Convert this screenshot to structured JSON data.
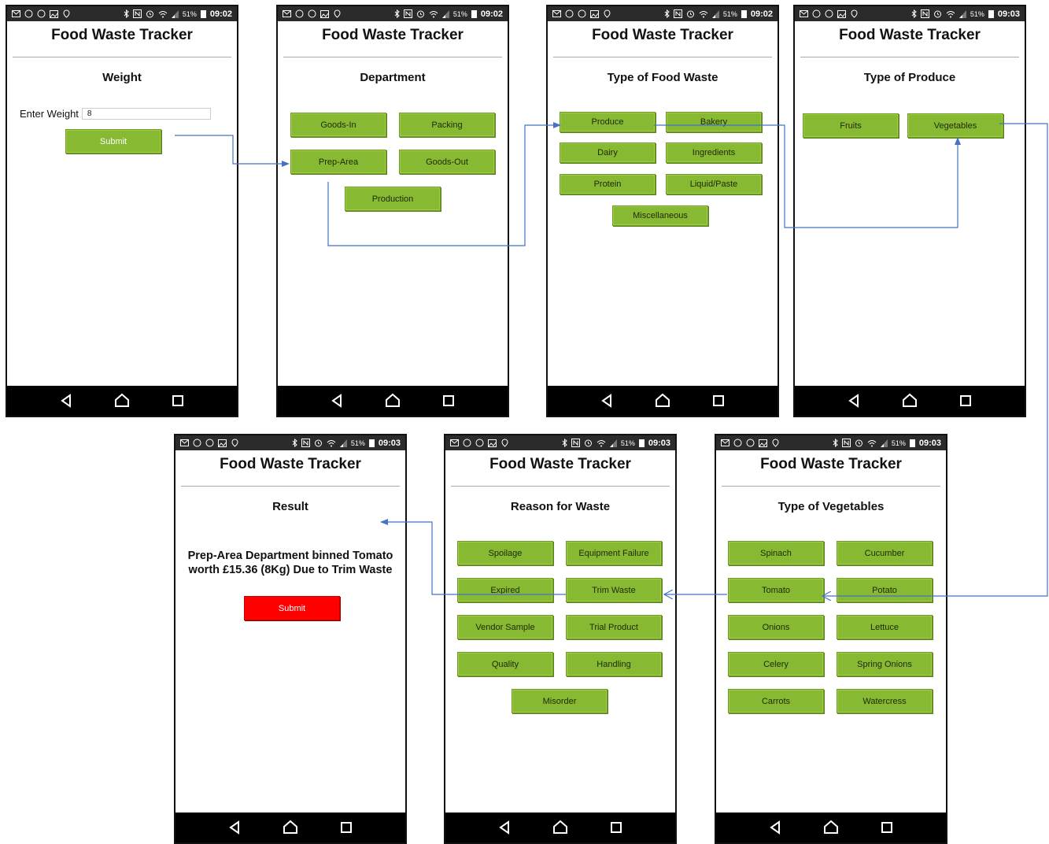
{
  "app_title": "Food Waste Tracker",
  "screens": {
    "weight": {
      "time": "09:02",
      "battery": "51%",
      "section": "Weight",
      "label": "Enter Weight",
      "value": "8",
      "submit": "Submit"
    },
    "department": {
      "time": "09:02",
      "battery": "51%",
      "section": "Department",
      "buttons": [
        "Goods-In",
        "Packing",
        "Prep-Area",
        "Goods-Out",
        "Production"
      ]
    },
    "food_type": {
      "time": "09:02",
      "battery": "51%",
      "section": "Type of Food Waste",
      "buttons": [
        "Produce",
        "Bakery",
        "Dairy",
        "Ingredients",
        "Protein",
        "Liquid/Paste",
        "Miscellaneous"
      ]
    },
    "produce": {
      "time": "09:03",
      "battery": "51%",
      "section": "Type of Produce",
      "buttons": [
        "Fruits",
        "Vegetables"
      ]
    },
    "vegetables": {
      "time": "09:03",
      "battery": "51%",
      "section": "Type of Vegetables",
      "buttons": [
        "Spinach",
        "Cucumber",
        "Tomato",
        "Potato",
        "Onions",
        "Lettuce",
        "Celery",
        "Spring Onions",
        "Carrots",
        "Watercress"
      ]
    },
    "reason": {
      "time": "09:03",
      "battery": "51%",
      "section": "Reason for Waste",
      "buttons": [
        "Spoilage",
        "Equipment Failure",
        "Expired",
        "Trim Waste",
        "Vendor Sample",
        "Trial Product",
        "Quality",
        "Handling",
        "Misorder"
      ]
    },
    "result": {
      "time": "09:03",
      "battery": "51%",
      "section": "Result",
      "text": "Prep-Area Department binned Tomato worth £15.36 (8Kg) Due to Trim Waste",
      "submit": "Submit"
    }
  },
  "colors": {
    "button_green": "#87b932",
    "submit_red": "#ff0000",
    "connector": "#4472c4"
  },
  "icons": [
    "mail-icon",
    "app-icon",
    "image-icon",
    "map-icon",
    "bluetooth-icon",
    "nfc-icon",
    "alarm-icon",
    "wifi-icon",
    "signal-icon",
    "battery-icon",
    "back-icon",
    "home-icon",
    "recents-icon"
  ]
}
